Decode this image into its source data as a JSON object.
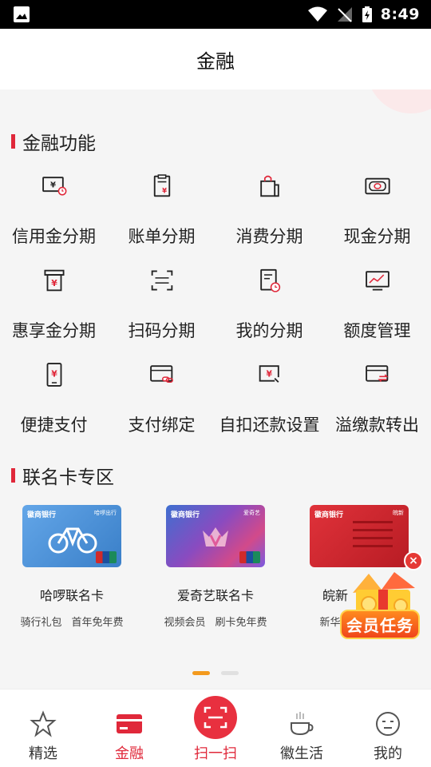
{
  "status_bar": {
    "time": "8:49"
  },
  "header": {
    "title": "金融"
  },
  "sections": {
    "finance": "金融功能",
    "cobrand": "联名卡专区"
  },
  "functions": [
    {
      "label": "信用金分期",
      "icon": "yuan-clock-icon"
    },
    {
      "label": "账单分期",
      "icon": "bill-icon"
    },
    {
      "label": "消费分期",
      "icon": "shopping-bag-icon"
    },
    {
      "label": "现金分期",
      "icon": "cash-icon"
    },
    {
      "label": "惠享金分期",
      "icon": "atm-yuan-icon"
    },
    {
      "label": "扫码分期",
      "icon": "scan-icon"
    },
    {
      "label": "我的分期",
      "icon": "document-clock-icon"
    },
    {
      "label": "额度管理",
      "icon": "chart-monitor-icon"
    },
    {
      "label": "便捷支付",
      "icon": "phone-yuan-icon"
    },
    {
      "label": "支付绑定",
      "icon": "card-link-icon"
    },
    {
      "label": "自扣还款设置",
      "icon": "yuan-screen-icon"
    },
    {
      "label": "溢缴款转出",
      "icon": "card-transfer-icon"
    }
  ],
  "cards": [
    {
      "name": "哈啰联名卡",
      "tags": [
        "骑行礼包",
        "首年免年费"
      ],
      "brand": "徽商银行",
      "partner": "哈啰出行",
      "color": "#4a90d6"
    },
    {
      "name": "爱奇艺联名卡",
      "tags": [
        "视频会员",
        "刷卡免年费"
      ],
      "brand": "徽商银行",
      "partner": "爱奇艺",
      "color": "#6b4bb0"
    },
    {
      "name": "皖新",
      "tags": [
        "新华书"
      ],
      "brand": "徽商银行",
      "partner": "皖新",
      "color": "#d8262e"
    }
  ],
  "member_task": {
    "label": "会员任务",
    "close": "×"
  },
  "tabbar": [
    {
      "label": "精选",
      "icon": "star-icon",
      "active": false
    },
    {
      "label": "金融",
      "icon": "card-icon",
      "active": true
    },
    {
      "label": "扫一扫",
      "icon": "scan-icon",
      "active": false
    },
    {
      "label": "徽生活",
      "icon": "coffee-icon",
      "active": false
    },
    {
      "label": "我的",
      "icon": "face-icon",
      "active": false
    }
  ],
  "colors": {
    "accent": "#e0283a",
    "indicator": "#f39a1e"
  }
}
